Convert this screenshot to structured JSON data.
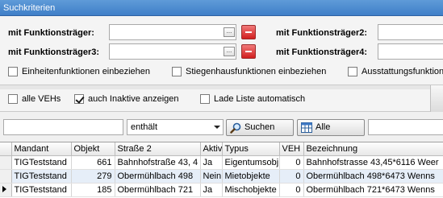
{
  "window": {
    "title": "Suchkriterien"
  },
  "filters": {
    "funk1_label": "mit Funktionsträger:",
    "funk2_label": "mit Funktionsträger2:",
    "funk3_label": "mit Funktionsträger3:",
    "funk4_label": "mit Funktionsträger4:",
    "funk1_value": "",
    "funk3_value": "",
    "browse_label": "...",
    "checkboxes": [
      {
        "label": "Einheitenfunktionen einbeziehen",
        "checked": false
      },
      {
        "label": "Stiegenhausfunktionen einbeziehen",
        "checked": false
      },
      {
        "label": "Ausstattungsfunktion",
        "checked": false
      }
    ]
  },
  "options": {
    "checkboxes": [
      {
        "label": "alle VEHs",
        "checked": false
      },
      {
        "label": "auch Inaktive anzeigen",
        "checked": true
      },
      {
        "label": "Lade Liste automatisch",
        "checked": false
      }
    ]
  },
  "search": {
    "term": "",
    "operator": "enthält",
    "search_button": "Suchen",
    "all_button": "Alle",
    "extra_value": ""
  },
  "table": {
    "columns": [
      "Mandant",
      "Objekt",
      "Straße 2",
      "Aktiv",
      "Typus",
      "VEH",
      "Bezeichnung"
    ],
    "rows": [
      {
        "mandant": "TIGTeststand",
        "objekt": "661",
        "strasse": "Bahnhofstraße 43, 4",
        "aktiv": "Ja",
        "typus": "Eigentumsobj",
        "veh": "0",
        "bezeichnung": "Bahnhofstrasse 43,45*6116 Weer",
        "current": false
      },
      {
        "mandant": "TIGTeststand",
        "objekt": "279",
        "strasse": "Obermühlbach 498",
        "aktiv": "Nein",
        "typus": "Mietobjekte",
        "veh": "0",
        "bezeichnung": "Obermühlbach 498*6473 Wenns",
        "current": false
      },
      {
        "mandant": "TIGTeststand",
        "objekt": "185",
        "strasse": "Obermühlbach 721",
        "aktiv": "Ja",
        "typus": "Mischobjekte",
        "veh": "0",
        "bezeichnung": "Obermühlbach 721*6473 Wenns",
        "current": true
      }
    ]
  },
  "colors": {
    "titlebar": "#4a8ad0",
    "delete": "#d11e1e",
    "alt_row": "#e6eef8"
  }
}
